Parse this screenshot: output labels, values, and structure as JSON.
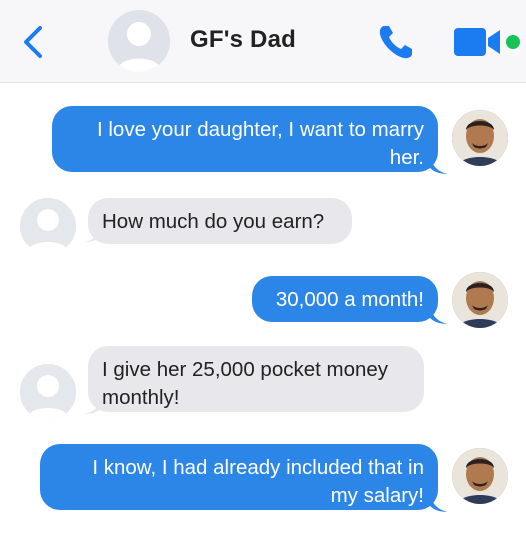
{
  "header": {
    "contact_name": "GF's Dad",
    "icons": {
      "back": "chevron-left-icon",
      "phone": "phone-icon",
      "video": "video-icon"
    },
    "accent_color": "#1a7cf0",
    "online_color": "#17c256"
  },
  "messages": [
    {
      "direction": "out",
      "lines": [
        "I love your daughter, I want to marry",
        "her."
      ]
    },
    {
      "direction": "in",
      "lines": [
        "How much do you earn?"
      ]
    },
    {
      "direction": "out",
      "lines": [
        "30,000 a month!"
      ]
    },
    {
      "direction": "in",
      "lines": [
        "I give her 25,000 pocket money",
        "monthly!"
      ]
    },
    {
      "direction": "out",
      "lines": [
        "I know, I had already included that in",
        "my salary!"
      ]
    }
  ],
  "colors": {
    "outgoing_bubble": "#2b86e8",
    "incoming_bubble": "#e8e8ec",
    "header_bg": "#f7f7f9"
  }
}
